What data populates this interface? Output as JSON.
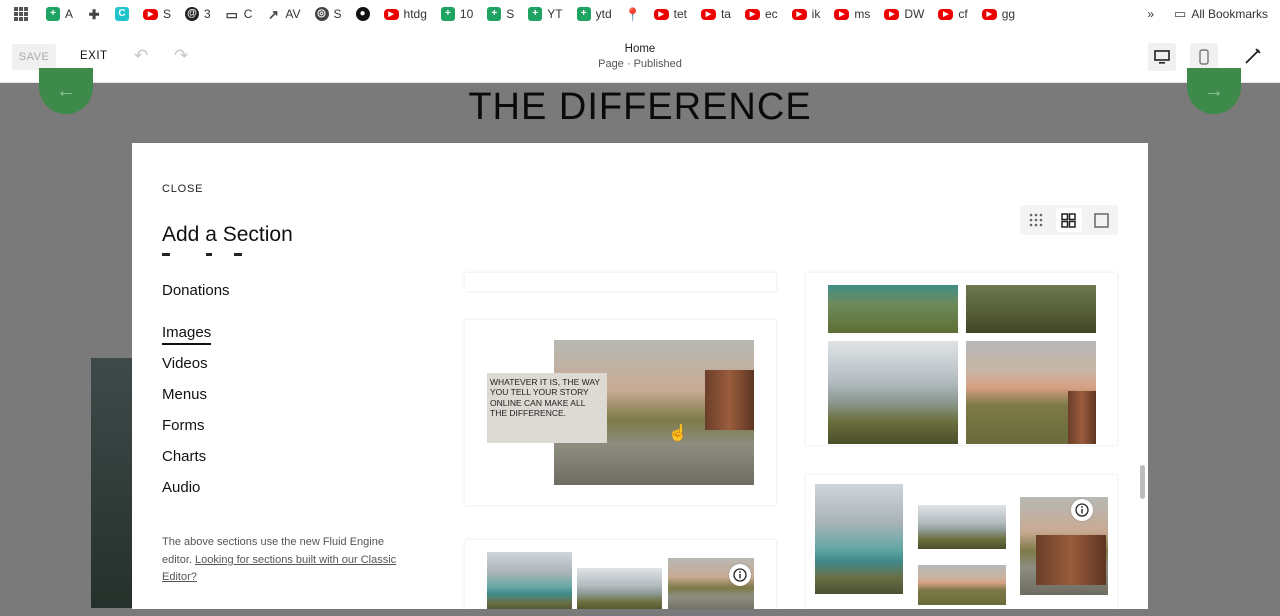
{
  "bookmarks": [
    {
      "icon": "sheets-icon",
      "glyph": "+",
      "cls": "sheet",
      "label": "A"
    },
    {
      "icon": "extension-icon",
      "glyph": "✚",
      "cls": "plain",
      "label": ""
    },
    {
      "icon": "canva-icon",
      "glyph": "C",
      "cls": "canva",
      "label": ""
    },
    {
      "icon": "youtube-icon",
      "glyph": "▶",
      "cls": "yt",
      "label": "S"
    },
    {
      "icon": "threads-icon",
      "glyph": "@",
      "cls": "ring",
      "label": "3"
    },
    {
      "icon": "folder-icon",
      "glyph": "▭",
      "cls": "plain",
      "label": "C"
    },
    {
      "icon": "trend-icon",
      "glyph": "↗",
      "cls": "plain",
      "label": "AV"
    },
    {
      "icon": "globe-icon",
      "glyph": "◎",
      "cls": "globe",
      "label": "S"
    },
    {
      "icon": "github-icon",
      "glyph": "●",
      "cls": "gh",
      "label": ""
    },
    {
      "icon": "youtube-icon",
      "glyph": "▶",
      "cls": "yt",
      "label": "htdg"
    },
    {
      "icon": "sheets-icon",
      "glyph": "+",
      "cls": "sheet",
      "label": "10"
    },
    {
      "icon": "sheets-icon",
      "glyph": "+",
      "cls": "sheet",
      "label": "S"
    },
    {
      "icon": "sheets-icon",
      "glyph": "+",
      "cls": "sheet",
      "label": "YT"
    },
    {
      "icon": "sheets-icon",
      "glyph": "+",
      "cls": "sheet",
      "label": "ytd"
    },
    {
      "icon": "pin-icon",
      "glyph": "📍",
      "cls": "plain",
      "label": ""
    },
    {
      "icon": "youtube-icon",
      "glyph": "▶",
      "cls": "yt",
      "label": "tet"
    },
    {
      "icon": "youtube-icon",
      "glyph": "▶",
      "cls": "yt",
      "label": "ta"
    },
    {
      "icon": "youtube-icon",
      "glyph": "▶",
      "cls": "yt",
      "label": "ec"
    },
    {
      "icon": "youtube-icon",
      "glyph": "▶",
      "cls": "yt",
      "label": "ik"
    },
    {
      "icon": "youtube-icon",
      "glyph": "▶",
      "cls": "yt",
      "label": "ms"
    },
    {
      "icon": "youtube-icon",
      "glyph": "▶",
      "cls": "yt",
      "label": "DW"
    },
    {
      "icon": "youtube-icon",
      "glyph": "▶",
      "cls": "yt",
      "label": "cf"
    },
    {
      "icon": "youtube-icon",
      "glyph": "▶",
      "cls": "yt",
      "label": "gg"
    }
  ],
  "bookmarks_overflow": "»",
  "all_bookmarks": "All Bookmarks",
  "editor": {
    "save": "SAVE",
    "exit": "EXIT",
    "page_title": "Home",
    "page_status": "Page · Published"
  },
  "page": {
    "headline": "THE DIFFERENCE",
    "arrow_left": "←",
    "arrow_right": "→"
  },
  "modal": {
    "close": "CLOSE",
    "title": "Add a Section",
    "categories": [
      "Donations",
      "Images",
      "Videos",
      "Menus",
      "Forms",
      "Charts",
      "Audio"
    ],
    "active_category": "Images",
    "footnote_text": "The above sections use the new Fluid Engine editor.",
    "footnote_link": "Looking for sections built with our Classic Editor?",
    "quote": "Whatever it is, the way you tell your story online can make all the difference."
  }
}
